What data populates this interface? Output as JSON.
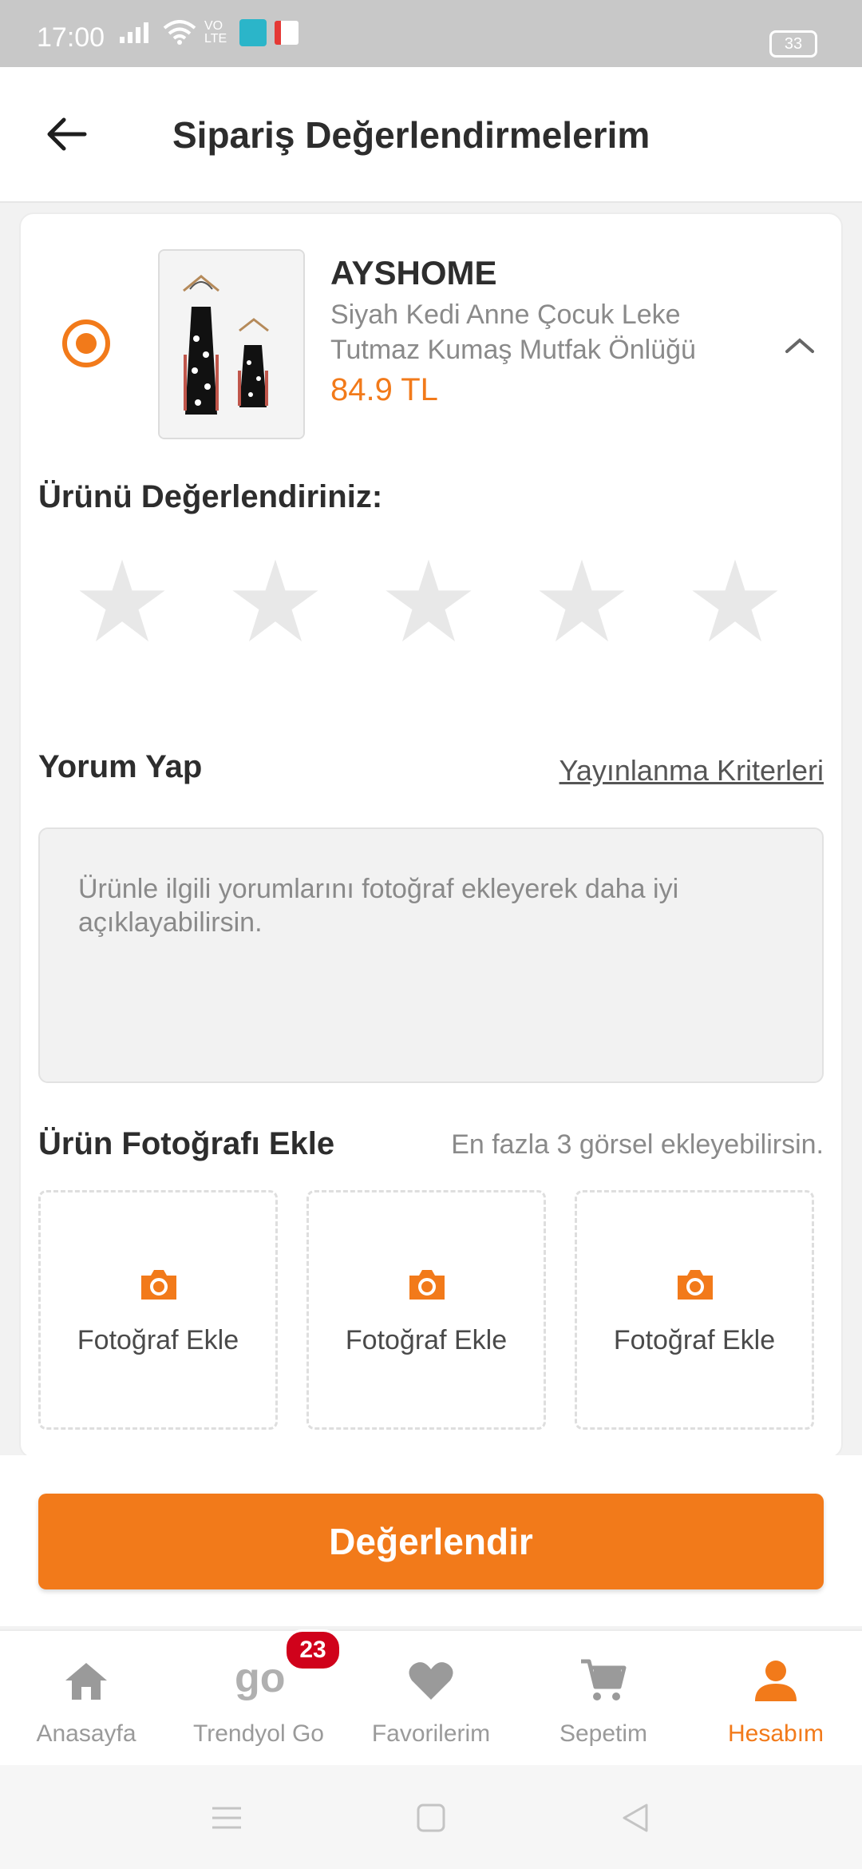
{
  "status_bar": {
    "time": "17:00",
    "network": "VO LTE",
    "battery": "33"
  },
  "app_bar": {
    "title": "Sipariş Değerlendirmelerim",
    "back_icon": "arrow-left-icon"
  },
  "product": {
    "brand": "AYSHOME",
    "name": "Siyah Kedi Anne Çocuk Leke Tutmaz Kumaş Mutfak Önlüğü",
    "price": "84.9 TL",
    "selected": true
  },
  "rating": {
    "label": "Ürünü Değerlendiriniz:",
    "max_stars": 5,
    "value": 0
  },
  "comment": {
    "label": "Yorum Yap",
    "criteria_link": "Yayınlanma Kriterleri",
    "placeholder": "Ürünle ilgili yorumlarını fotoğraf ekleyerek daha iyi açıklayabilirsin."
  },
  "photos": {
    "label": "Ürün Fotoğrafı Ekle",
    "hint": "En fazla 3 görsel ekleyebilirsin.",
    "slots": [
      {
        "label": "Fotoğraf Ekle"
      },
      {
        "label": "Fotoğraf Ekle"
      },
      {
        "label": "Fotoğraf Ekle"
      }
    ]
  },
  "submit_label": "Değerlendir",
  "tabs": [
    {
      "label": "Anasayfa",
      "icon": "home-icon"
    },
    {
      "label": "Trendyol Go",
      "icon": "go-icon",
      "badge": "23"
    },
    {
      "label": "Favorilerim",
      "icon": "heart-icon"
    },
    {
      "label": "Sepetim",
      "icon": "cart-icon"
    },
    {
      "label": "Hesabım",
      "icon": "user-icon",
      "active": true
    }
  ],
  "colors": {
    "accent": "#f27a1a",
    "badge": "#d0021b",
    "star_empty": "#e8e8e8"
  }
}
